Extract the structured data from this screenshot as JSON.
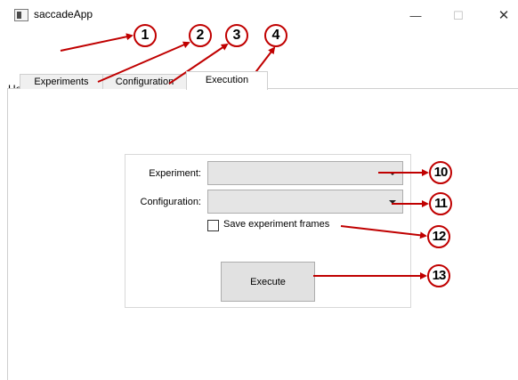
{
  "window": {
    "title": "saccadeApp",
    "controls": {
      "minimize": "—",
      "maximize": "☐",
      "close": "✕"
    }
  },
  "menu": {
    "help": "Help"
  },
  "tabs": [
    {
      "label": "Experiments",
      "active": false
    },
    {
      "label": "Configuration",
      "active": false
    },
    {
      "label": "Execution",
      "active": true
    }
  ],
  "execution": {
    "experiment_label": "Experiment:",
    "experiment_value": "",
    "configuration_label": "Configuration:",
    "configuration_value": "",
    "save_frames_label": "Save experiment frames",
    "save_frames_checked": false,
    "execute_button": "Execute"
  },
  "callouts": [
    "1",
    "2",
    "3",
    "4",
    "10",
    "11",
    "12",
    "13"
  ],
  "colors": {
    "callout": "#c00000",
    "arrow": "#c00000",
    "button_bg": "#e1e1e1",
    "combo_bg": "#e5e5e5"
  }
}
